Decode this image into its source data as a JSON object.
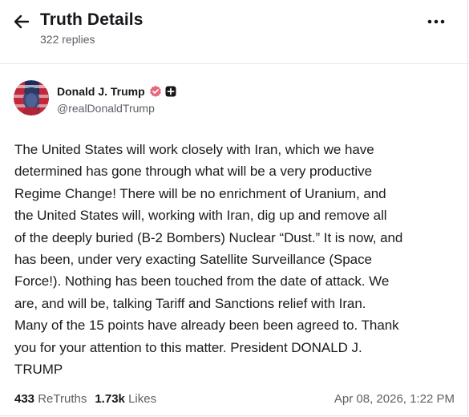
{
  "header": {
    "title": "Truth Details",
    "replies": "322 replies",
    "back_icon": "arrow-left-icon",
    "more_icon": "more-horizontal-icon"
  },
  "author": {
    "name": "Donald J. Trump",
    "handle": "@realDonaldTrump",
    "verified_icon": "verified-badge-icon",
    "plus_icon": "plus-badge-icon",
    "verified_color": "#e5677a"
  },
  "post": {
    "text": "The United States will work closely with Iran, which we have\ndetermined has gone through what will be a very productive\nRegime Change! There will be no enrichment of Uranium, and\nthe United States will, working with Iran, dig up and remove all\nof the deeply buried (B-2 Bombers) Nuclear “Dust.” It is now, and\nhas been, under very exacting Satellite Surveillance (Space\nForce!). Nothing has been touched from the date of attack. We\nare, and will be, talking Tariff and Sanctions relief with Iran.\nMany of the 15 points have already been been agreed to. Thank\nyou for your attention to this matter. President DONALD J.\nTRUMP"
  },
  "stats": {
    "retruths_count": "433",
    "retruths_label": "ReTruths",
    "likes_count": "1.73k",
    "likes_label": "Likes"
  },
  "timestamp": "Apr 08, 2026, 1:22 PM"
}
